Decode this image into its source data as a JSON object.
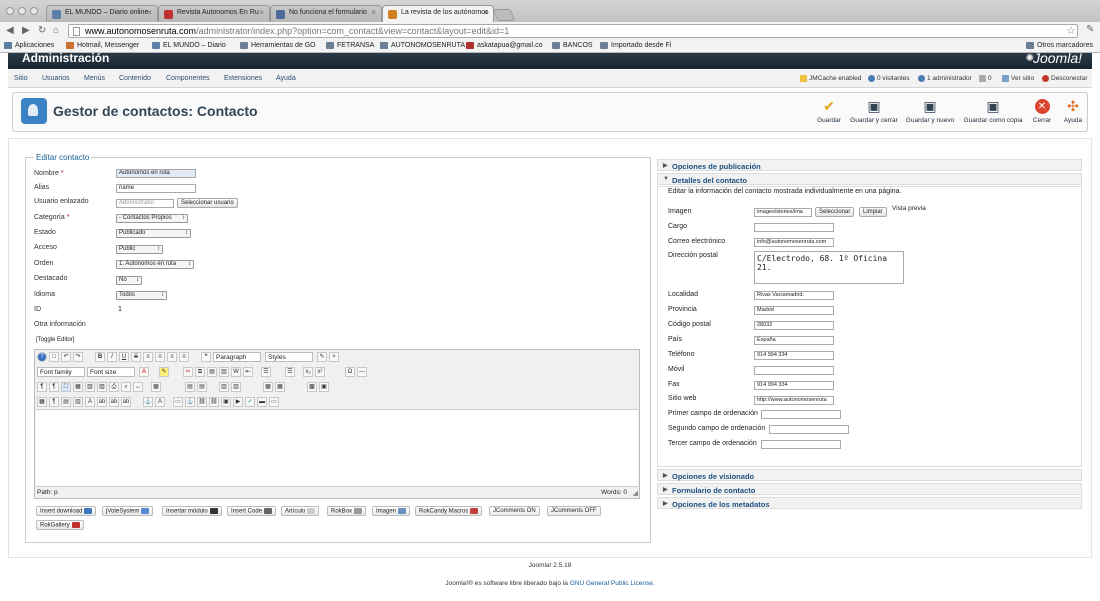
{
  "browser": {
    "tabs": [
      {
        "label": "EL MUNDO – Diario online",
        "color": "#5b7fa6"
      },
      {
        "label": "Revista Autonomos En Ru",
        "color": "#c03030"
      },
      {
        "label": "No funciona el formulario",
        "color": "#4a6a9a"
      },
      {
        "label": "La revista de los autónomos",
        "color": "#d08020"
      }
    ],
    "url_host": "www.autonomosenruta.com",
    "url_path": "/administrator/index.php?option=com_contact&view=contact&layout=edit&id=1",
    "bookmarks": [
      "Aplicaciones",
      "Hotmail, Messenger",
      "EL MUNDO – Diario",
      "Herramientas de GO",
      "FETRANSA",
      "AUTONOMOSENRUTA",
      "askatapua@gmail.co",
      "BANCOS",
      "Importado desde Fi"
    ],
    "other_bookmarks": "Otros marcadores"
  },
  "header": {
    "admin_title": "Administración",
    "logo_text": "Joomla!"
  },
  "menu": {
    "items": [
      "Sitio",
      "Usuarios",
      "Menús",
      "Contenido",
      "Componentes",
      "Extensiones",
      "Ayuda"
    ],
    "status": {
      "jmcache": "JMCache enabled",
      "visitors": "0 visitantes",
      "admins": "1 administrador",
      "messages": "0",
      "view_site": "Ver sitio",
      "logout": "Desconectar"
    }
  },
  "toolbar": {
    "title": "Gestor de contactos: Contacto",
    "buttons": {
      "save": "Guardar",
      "save_close": "Guardar y cerrar",
      "save_new": "Guardar y nuevo",
      "save_copy": "Guardar como copia",
      "close": "Cerrar",
      "help": "Ayuda"
    }
  },
  "form": {
    "legend": "Editar contacto",
    "fields": {
      "name": {
        "label": "Nombre",
        "value": "Autonomos en ruta"
      },
      "alias": {
        "label": "Alias",
        "value": "name"
      },
      "user": {
        "label": "Usuario enlazado",
        "placeholder": "Administrator",
        "button": "Seleccionar usuario"
      },
      "category": {
        "label": "Categoría",
        "value": "- Contactos Propios"
      },
      "state": {
        "label": "Estado",
        "value": "Publicado"
      },
      "access": {
        "label": "Acceso",
        "value": "Public"
      },
      "order": {
        "label": "Orden",
        "value": "1. Autonomos en ruta"
      },
      "featured": {
        "label": "Destacado",
        "value": "No"
      },
      "language": {
        "label": "Idioma",
        "value": "Todos"
      },
      "id": {
        "label": "ID",
        "value": "1"
      },
      "other": {
        "label": "Otra información"
      }
    },
    "toggle_editor": "[Toggle Editor]",
    "editor": {
      "paragraph": "Paragraph",
      "styles": "Styles",
      "font_family": "Font family",
      "font_size": "Font size",
      "path": "Path:",
      "path_value": "p",
      "words": "Words: 0"
    },
    "extra_buttons": [
      "Insert download",
      "jVoteSystem",
      "Insertar módulo",
      "Insert Code",
      "Artículo",
      "RokBox",
      "Imagen",
      "RokCandy Macros",
      "JComments ON",
      "JComments OFF",
      "RokGallery"
    ]
  },
  "panels": {
    "publishing": "Opciones de publicación",
    "details": "Detalles del contacto",
    "display": "Opciones de visionado",
    "contact_form": "Formulario de contacto",
    "metadata": "Opciones de los metadatos"
  },
  "details": {
    "description": "Editar la información del contacto mostrada individualmente en una página.",
    "image": {
      "label": "Imagen",
      "value": "images/stories/ima",
      "select": "Seleccionar",
      "clear": "Limpiar",
      "preview": "Vista previa"
    },
    "position": {
      "label": "Cargo",
      "value": ""
    },
    "email": {
      "label": "Correo electrónico",
      "value": "info@autonomosenruta.com"
    },
    "address": {
      "label": "Dirección postal",
      "value": "C/Electrodo, 68. 1º Oficina 21."
    },
    "city": {
      "label": "Localidad",
      "value": "Rivas Vaciamadrid."
    },
    "province": {
      "label": "Provincia",
      "value": "Madrid"
    },
    "postcode": {
      "label": "Código postal",
      "value": "28032"
    },
    "country": {
      "label": "País",
      "value": "España"
    },
    "phone": {
      "label": "Teléfono",
      "value": "914 994 334"
    },
    "mobile": {
      "label": "Móvil",
      "value": ""
    },
    "fax": {
      "label": "Fax",
      "value": "914 994 334"
    },
    "website": {
      "label": "Sitio web",
      "value": "http://www.autonomosenruta"
    },
    "sort1": {
      "label": "Primer campo de ordenación",
      "value": ""
    },
    "sort2": {
      "label": "Segundo campo de ordenación",
      "value": ""
    },
    "sort3": {
      "label": "Tercer campo de ordenación",
      "value": ""
    }
  },
  "footer": {
    "version": "Joomla! 2.5.18",
    "license_pre": "Joomla!® es software libre liberado bajo la",
    "license_link": "GNU General Public License."
  }
}
